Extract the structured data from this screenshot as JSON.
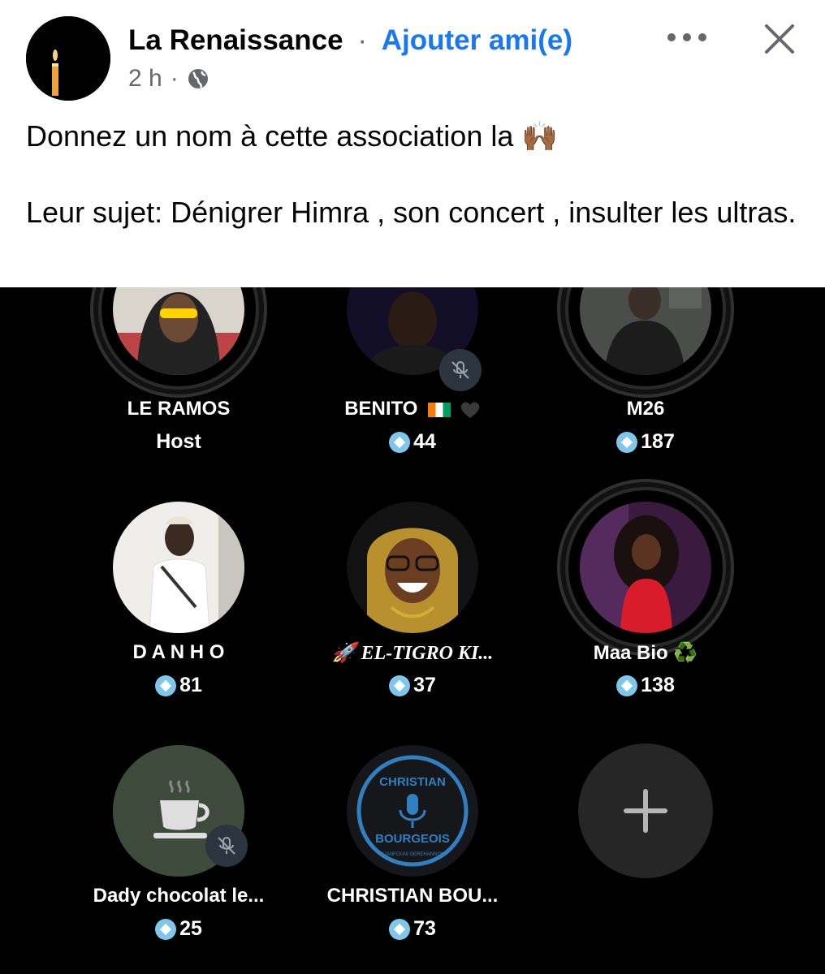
{
  "post": {
    "author": "La Renaissance",
    "separator": "·",
    "add_friend": "Ajouter ami(e)",
    "time": "2 h",
    "meta_separator": "·",
    "line1": "Donnez un nom à cette association la 🙌🏾",
    "line2": "Leur sujet: Dénigrer Himra , son concert , insulter les ultras."
  },
  "icons": {
    "more": "more-options-icon",
    "close": "close-icon",
    "privacy": "globe-icon",
    "muted": "mic-off-icon",
    "coin": "diamond-icon",
    "add": "plus-icon"
  },
  "colors": {
    "accent": "#1877f2",
    "coin": "#7fc7ea",
    "background_room": "#000000"
  },
  "participants": [
    {
      "name": "LE RAMOS",
      "sub": "Host"
    },
    {
      "name": "BENITO",
      "count": "44",
      "muted": true
    },
    {
      "name": "M26",
      "count": "187"
    },
    {
      "name": "D A N H O",
      "count": "81"
    },
    {
      "name": "🚀 EL-TIGRO KI...",
      "count": "37"
    },
    {
      "name": "Maa Bio ♻️",
      "count": "138"
    },
    {
      "name": "Dady chocolat le...",
      "count": "25",
      "muted": true
    },
    {
      "name": "CHRISTIAN BOU...",
      "count": "73"
    }
  ],
  "logo_text": {
    "top": "CHRISTIAN",
    "bottom": "BOURGEOIS",
    "ring": "DJANFOUNI GEREHANNON"
  }
}
